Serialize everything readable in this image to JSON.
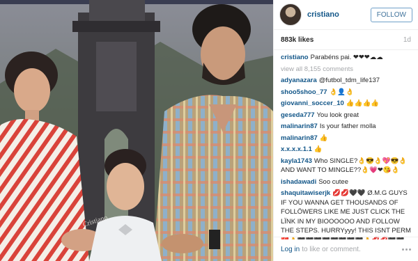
{
  "post": {
    "username": "cristiano",
    "follow_label": "FOLLOW",
    "likes": "883k likes",
    "age": "1d",
    "watermark": "Cristiano"
  },
  "caption": {
    "user": "cristiano",
    "text": "Parabéns pai. ❤❤❤☁☁"
  },
  "view_all": "view all 8,155 comments",
  "comments": [
    {
      "user": "adyanazara",
      "text": "@futbol_tdm_life137"
    },
    {
      "user": "shoo5shoo_77",
      "text": "👌👤👌"
    },
    {
      "user": "giovanni_soccer_10",
      "text": "👍👍👍👍"
    },
    {
      "user": "geseda777",
      "text": "You look great"
    },
    {
      "user": "malinarin87",
      "text": "Is your father molla"
    },
    {
      "user": "malinarin87",
      "text": "👍"
    },
    {
      "user": "x.x.x.x.1.1",
      "text": "👍"
    },
    {
      "user": "kayla1743",
      "text": "Who SINGLE?👌😎👌💖😎👌 AND WANT TO MINGLE??👌💗❤😘👌"
    },
    {
      "user": "ishadawadi",
      "text": "Soo cutee"
    },
    {
      "user": "shaquitawiserjk",
      "text": "💋💋🖤🖤 Ø.M.G GUYS IF YOU WANNA GET THOUSANDS OF FOLLÖWERS LIKE ME JUST CLICK THE LÏNK IN MY BIOOOOOO AND FOLLOW THE STEPS. HURRYyyy! THIS ISNT PERM 💔👌🖤🖤🖤🖤🖤🖤🖤🖤👌💋💋🖤🖤👌"
    }
  ],
  "footer": {
    "login": "Log in",
    "rest": "to like or comment."
  }
}
